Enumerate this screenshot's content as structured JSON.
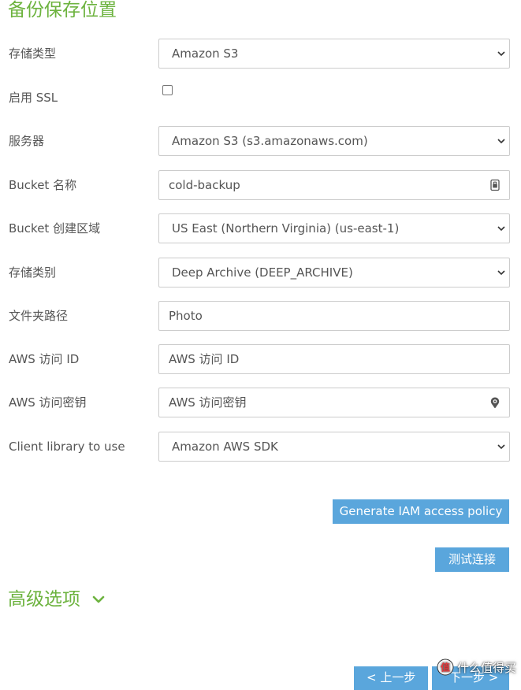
{
  "section_title": "备份保存位置",
  "form": {
    "storage_type": {
      "label": "存储类型",
      "value": "Amazon S3"
    },
    "enable_ssl": {
      "label": "启用 SSL",
      "checked": false
    },
    "server": {
      "label": "服务器",
      "value": "Amazon S3 (s3.amazonaws.com)"
    },
    "bucket_name": {
      "label": "Bucket 名称",
      "value": "cold-backup"
    },
    "bucket_region": {
      "label": "Bucket 创建区域",
      "value": "US East (Northern Virginia) (us-east-1)"
    },
    "storage_class": {
      "label": "存储类别",
      "value": "Deep Archive (DEEP_ARCHIVE)"
    },
    "folder_path": {
      "label": "文件夹路径",
      "value": "Photo"
    },
    "aws_access_id": {
      "label": "AWS 访问 ID",
      "placeholder": "AWS 访问 ID"
    },
    "aws_secret_key": {
      "label": "AWS 访问密钥",
      "placeholder": "AWS 访问密钥"
    },
    "client_library": {
      "label": "Client library to use",
      "value": "Amazon AWS SDK"
    }
  },
  "buttons": {
    "generate_iam": "Generate IAM access policy",
    "test_connection": "测试连接",
    "prev": "< 上一步",
    "next": "下一步 >"
  },
  "advanced": {
    "title": "高级选项"
  },
  "watermark": {
    "text": "什么值得买"
  },
  "colors": {
    "accent_green": "#6db33f",
    "button_blue": "#5aa6dc",
    "border": "#cccccc",
    "text": "#555555"
  },
  "icons": {
    "select_chevron": "chevron-down-icon",
    "bucket_field": "password-manager-icon",
    "secret_field": "password-visibility-icon",
    "advanced_toggle": "chevron-down-icon"
  }
}
